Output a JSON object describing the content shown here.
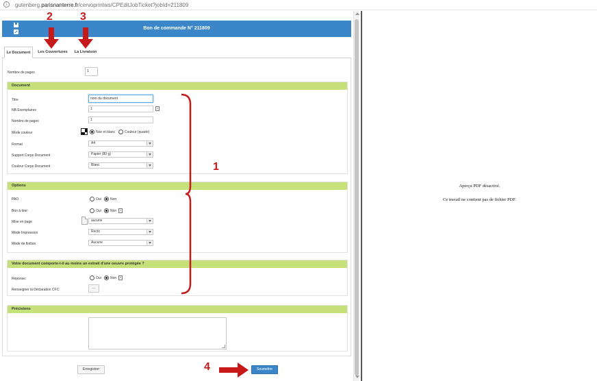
{
  "browser": {
    "url_prefix": "gutenberg.",
    "url_domain": "parisnanterre.fr",
    "url_path": "/cervoprintws/CPEditJobTicket?jobId=211809"
  },
  "header": {
    "title": "Bon de commande N° 211809"
  },
  "tabs": [
    {
      "label": "Le Document",
      "active": true
    },
    {
      "label": "Les Couvertures",
      "active": false
    },
    {
      "label": "La Livraison",
      "active": false
    }
  ],
  "top_field": {
    "label": "Nombre de pages",
    "value": "1"
  },
  "document_section": {
    "title": "Document",
    "titre_label": "Titre",
    "titre_placeholder": "nom du document",
    "exemplaires_label": "NB Exemplaires",
    "exemplaires_value": "1",
    "pages_label": "Nombre de pages",
    "pages_value": "1",
    "couleur_label": "Mode couleur",
    "couleur_opt1": "Noir et blanc",
    "couleur_opt2": "Couleur (quadri)",
    "format_label": "Format",
    "format_value": "A4",
    "support_label": "Support Corps Document",
    "support_value": "Papier (80 g)",
    "couleur_corps_label": "Couleur Corps Document",
    "couleur_corps_value": "Blanc"
  },
  "options_section": {
    "title": "Options",
    "pao_label": "PAO",
    "bat_label": "Bon à tirer:",
    "oui": "Oui",
    "non": "Non",
    "mise_label": "Mise en page",
    "mise_value": "aucune",
    "impression_label": "Mode Impression",
    "impression_value": "Recto",
    "finition_label": "Mode de finition",
    "finition_value": "Aucune"
  },
  "protected_section": {
    "title": "Votre document comporte-t-il au moins un extrait d'une oeuvre protégée ?",
    "reponse_label": "Réponse:",
    "cfc_label": "Renseigner la Déclaration CFC:",
    "cfc_button": "..."
  },
  "precisions_section": {
    "title": "Précisions"
  },
  "help_glyph": "?",
  "footer": {
    "save_label": "Enregistrer",
    "submit_label": "Soumettre"
  },
  "preview": {
    "line1": "Aperçu PDF désactivé.",
    "line2": "Ce travail ne contient pas de fichier PDF."
  },
  "annotations": {
    "n1": "1",
    "n2": "2",
    "n3": "3",
    "n4": "4",
    "color": "#c8191a"
  }
}
